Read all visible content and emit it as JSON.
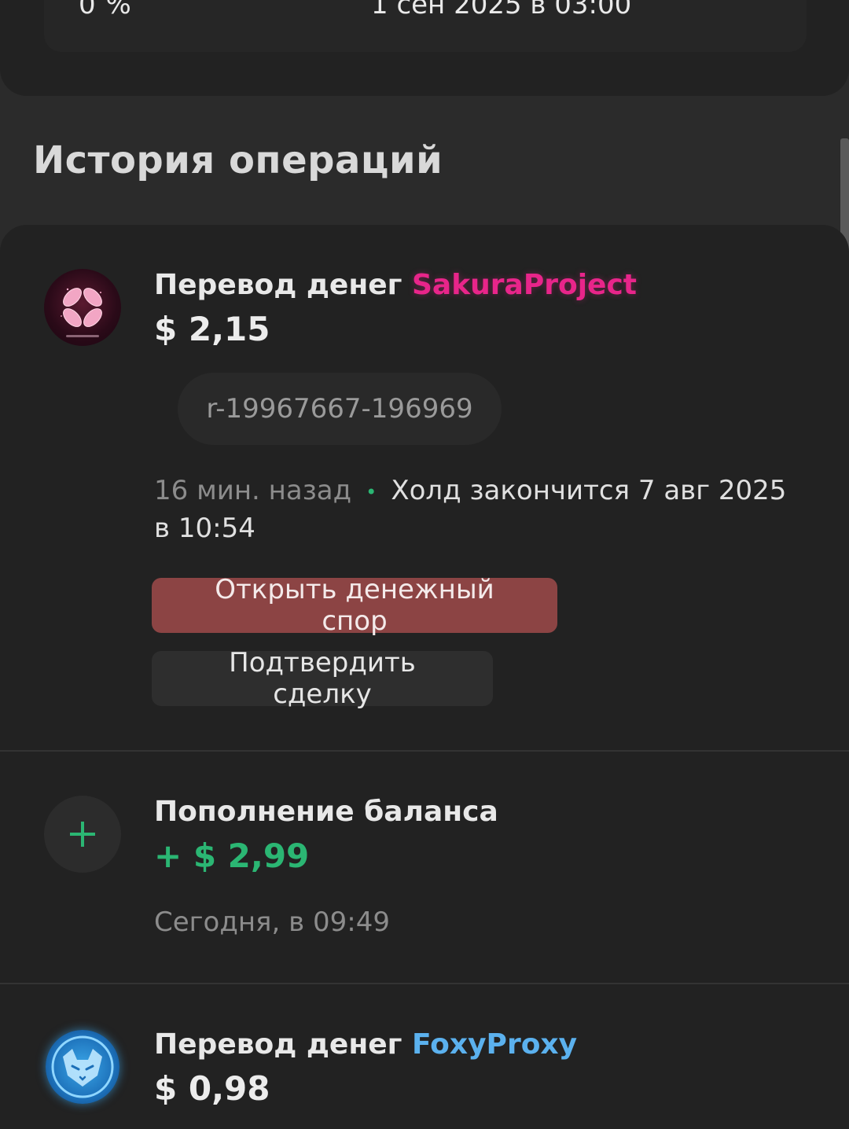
{
  "top_card": {
    "left_value": "0 %",
    "right_value": "1 сен 2025 в 03:00"
  },
  "history": {
    "title": "История операций",
    "items": [
      {
        "title_prefix": "Перевод денег",
        "counterparty": "SakuraProject",
        "amount": "$ 2,15",
        "reference": "r-19967667-196969",
        "time": "16 мин. назад",
        "separator": "•",
        "hold": "Холд закончится 7 авг 2025 в 10:54",
        "dispute_button": "Открыть денежный спор",
        "confirm_button": "Подтвердить сделку",
        "avatar_icon": "sakura-flower-icon",
        "accent": "#e8258a"
      },
      {
        "title": "Пополнение баланса",
        "amount": "+ $ 2,99",
        "time": "Сегодня, в 09:49",
        "avatar_icon": "plus-icon",
        "accent": "#2bb673"
      },
      {
        "title_prefix": "Перевод денег",
        "counterparty": "FoxyProxy",
        "amount": "$ 0,98",
        "avatar_icon": "fox-icon",
        "accent": "#5bb1ee"
      }
    ]
  },
  "colors": {
    "background": "#2b2b2b",
    "card": "#222222",
    "dispute_button": "#8c4444",
    "positive": "#2bb673"
  }
}
